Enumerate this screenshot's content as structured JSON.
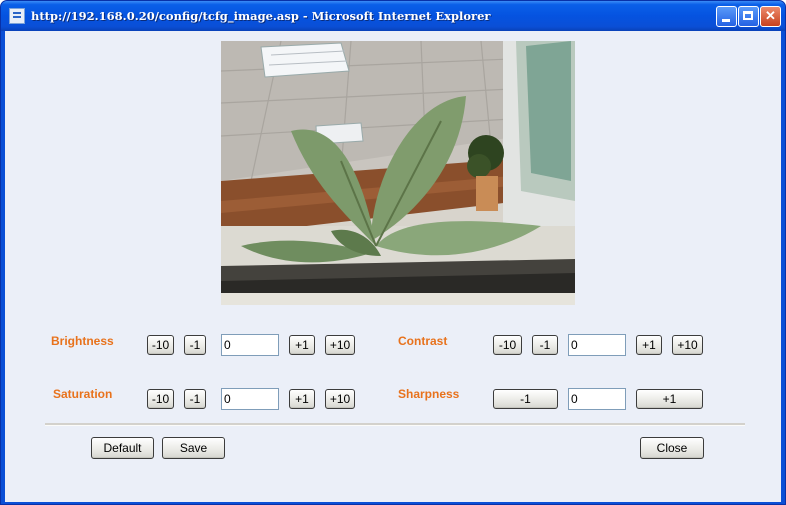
{
  "window": {
    "title": "http://192.168.0.20/config/tcfg_image.asp - Microsoft Internet Explorer",
    "controls": {
      "minimize": "minimize-icon",
      "maximize": "maximize-icon",
      "close": "close-icon"
    }
  },
  "preview": {
    "alt": "camera live image"
  },
  "brightness": {
    "label": "Brightness",
    "minus10": "-10",
    "minus1": "-1",
    "value": "0",
    "plus1": "+1",
    "plus10": "+10"
  },
  "contrast": {
    "label": "Contrast",
    "minus10": "-10",
    "minus1": "-1",
    "value": "0",
    "plus1": "+1",
    "plus10": "+10"
  },
  "saturation": {
    "label": "Saturation",
    "minus10": "-10",
    "minus1": "-1",
    "value": "0",
    "plus1": "+1",
    "plus10": "+10"
  },
  "sharpness": {
    "label": "Sharpness",
    "minus1": "-1",
    "value": "0",
    "plus1": "+1"
  },
  "actions": {
    "default": "Default",
    "save": "Save",
    "close": "Close"
  },
  "colors": {
    "label": "#e8721c",
    "titlebar": "#0a4fd6",
    "client_bg": "#ebeff8"
  }
}
